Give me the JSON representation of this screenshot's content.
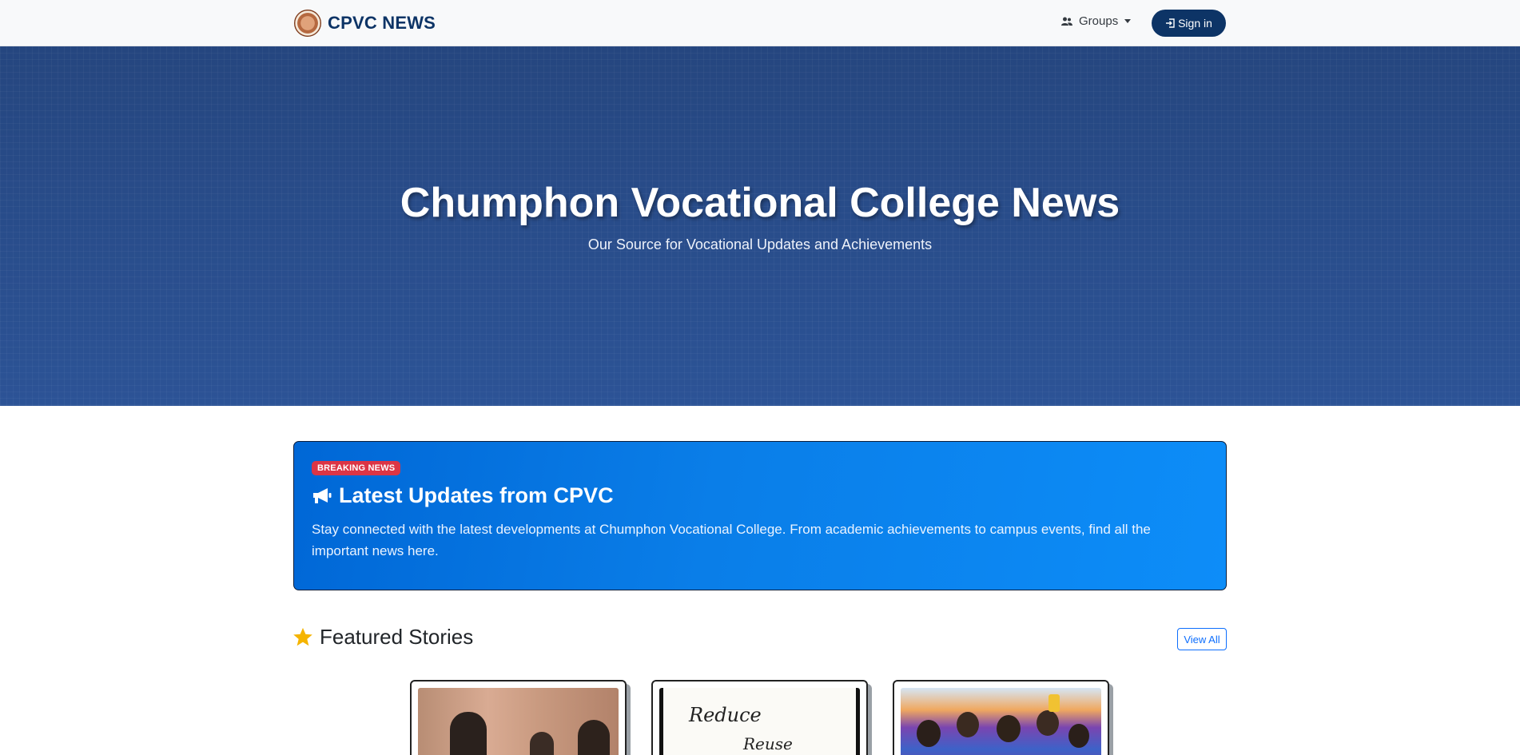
{
  "nav": {
    "brand": "CPVC NEWS",
    "groups_label": "Groups",
    "signin_label": "Sign in",
    "icons": {
      "groups": "users-icon",
      "signin": "login-icon",
      "logo": "college-seal-logo"
    }
  },
  "hero": {
    "title": "Chumphon Vocational College News",
    "subtitle": "Our Source for Vocational Updates and Achievements"
  },
  "breaking": {
    "badge": "BREAKING NEWS",
    "title": "Latest Updates from CPVC",
    "text": "Stay connected with the latest developments at Chumphon Vocational College. From academic achievements to campus events, find all the important news here.",
    "icon": "megaphone-icon"
  },
  "featured": {
    "heading": "Featured Stories",
    "view_all": "View All",
    "icon": "star-icon",
    "cards": [
      {
        "image": "students-meeting-photo"
      },
      {
        "image": "handwritten-note-photo",
        "handwriting": [
          "Reduce",
          "Reuse"
        ]
      },
      {
        "image": "students-group-celebration-photo"
      }
    ]
  },
  "colors": {
    "brand": "#0d3466",
    "hero": "#2a4f8f",
    "breaking_bg": "#0a7ee8",
    "badge": "#dc3545",
    "link": "#0d6efd",
    "star": "#f5b400"
  }
}
